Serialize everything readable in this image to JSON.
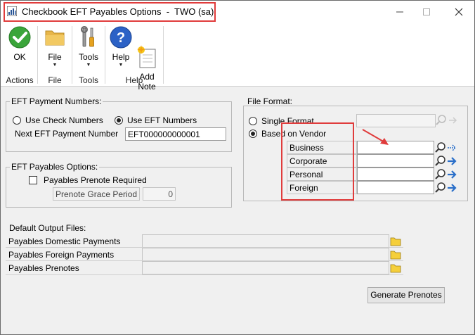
{
  "window": {
    "title": "Checkbook EFT Payables Options  -  TWO (sa)"
  },
  "ribbon": {
    "buttons": {
      "ok": "OK",
      "file": "File",
      "tools": "Tools",
      "help": "Help",
      "add_note": "Add\nNote"
    },
    "groups": {
      "actions": "Actions",
      "file": "File",
      "tools": "Tools",
      "help": "Help"
    }
  },
  "eft_payment_numbers": {
    "label": "EFT Payment Numbers:",
    "use_check_numbers": "Use Check Numbers",
    "use_eft_numbers": "Use EFT Numbers",
    "selected": "use_eft_numbers",
    "next_label": "Next EFT Payment Number",
    "next_value": "EFT000000000001"
  },
  "eft_payables_options": {
    "label": "EFT Payables Options:",
    "prenote_required": "Payables Prenote Required",
    "prenote_required_checked": false,
    "grace_period_label": "Prenote Grace Period",
    "grace_period_value": "0"
  },
  "file_format": {
    "label": "File Format:",
    "single_format": "Single Format",
    "based_on_vendor": "Based on Vendor",
    "selected": "based_on_vendor",
    "rows": [
      {
        "label": "Business",
        "value": ""
      },
      {
        "label": "Corporate",
        "value": ""
      },
      {
        "label": "Personal",
        "value": ""
      },
      {
        "label": "Foreign",
        "value": ""
      }
    ]
  },
  "default_output_files": {
    "label": "Default Output Files:",
    "rows": [
      {
        "label": "Payables Domestic Payments",
        "value": ""
      },
      {
        "label": "Payables Foreign Payments",
        "value": ""
      },
      {
        "label": "Payables Prenotes",
        "value": ""
      }
    ]
  },
  "generate_prenotes": "Generate Prenotes",
  "colors": {
    "annotation_red": "#e03c3c",
    "lookup_blue": "#2a6fc9",
    "folder_yellow": "#f5cf3b"
  }
}
